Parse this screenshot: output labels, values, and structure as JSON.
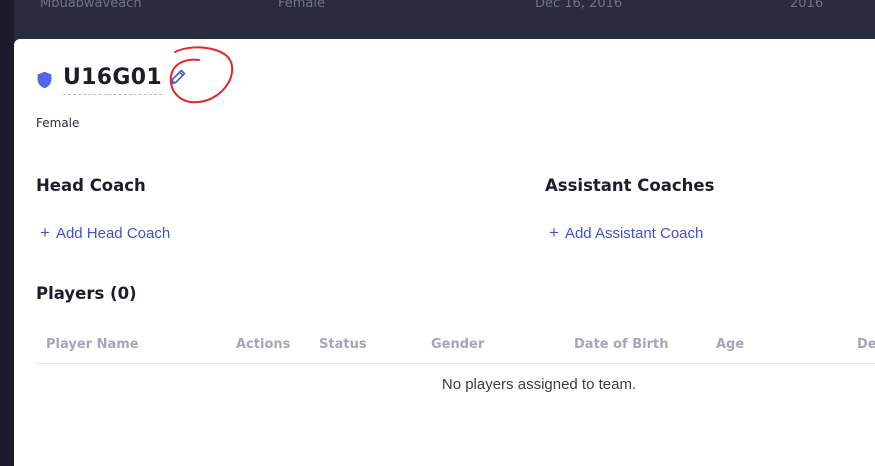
{
  "background_row": {
    "cells": [
      "Mbuabwaveach",
      "Female",
      "Dec 16, 2016",
      "2016"
    ]
  },
  "team": {
    "name": "U16G01",
    "gender": "Female",
    "accent_color": "#5567e8"
  },
  "head_coach": {
    "title": "Head Coach",
    "add_label": "Add Head Coach"
  },
  "assistant_coaches": {
    "title": "Assistant Coaches",
    "add_label": "Add Assistant Coach"
  },
  "players": {
    "title": "Players (0)",
    "columns": [
      "Player Name",
      "Actions",
      "Status",
      "Gender",
      "Date of Birth",
      "Age",
      "De"
    ],
    "empty_message": "No players assigned to team."
  },
  "icons": {
    "team": "shield-icon",
    "edit": "pencil-icon",
    "add": "plus-icon"
  }
}
